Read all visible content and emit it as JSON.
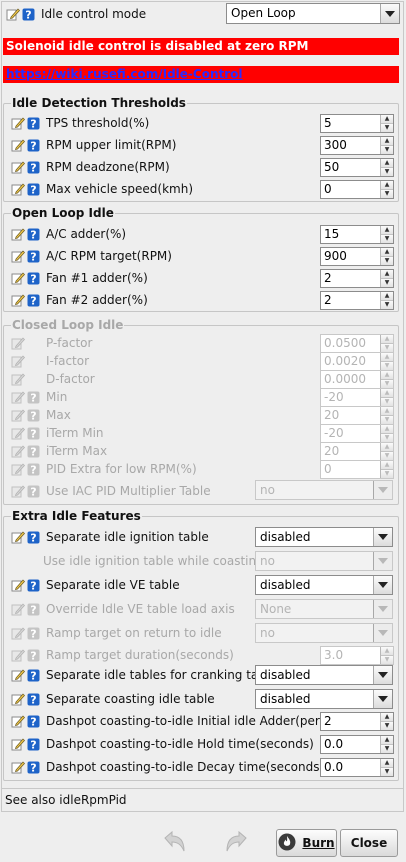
{
  "header": {
    "mode_label": "Idle control mode",
    "mode_value": "Open Loop"
  },
  "banners": {
    "warning": "Solenoid idle control is disabled at zero RPM",
    "link": "https://wiki.rusefi.com/Idle-Control"
  },
  "detection": {
    "title": "Idle Detection Thresholds",
    "fields": [
      {
        "label": "TPS threshold(%)",
        "value": "5"
      },
      {
        "label": "RPM upper limit(RPM)",
        "value": "300"
      },
      {
        "label": "RPM deadzone(RPM)",
        "value": "50"
      },
      {
        "label": "Max vehicle speed(kmh)",
        "value": "0"
      }
    ]
  },
  "open_loop": {
    "title": "Open Loop Idle",
    "fields": [
      {
        "label": "A/C adder(%)",
        "value": "15"
      },
      {
        "label": "A/C RPM target(RPM)",
        "value": "900"
      },
      {
        "label": "Fan #1 adder(%)",
        "value": "2"
      },
      {
        "label": "Fan #2 adder(%)",
        "value": "2"
      }
    ]
  },
  "closed_loop": {
    "title": "Closed Loop Idle",
    "fields": [
      {
        "label": "P-factor",
        "value": "0.0500"
      },
      {
        "label": "I-factor",
        "value": "0.0020"
      },
      {
        "label": "D-factor",
        "value": "0.0000"
      },
      {
        "label": "Min",
        "value": "-20"
      },
      {
        "label": "Max",
        "value": "20"
      },
      {
        "label": "iTerm Min",
        "value": "-20"
      },
      {
        "label": "iTerm Max",
        "value": "20"
      },
      {
        "label": "PID Extra for low RPM(%)",
        "value": "0"
      }
    ],
    "multiplier_label": "Use IAC PID Multiplier Table",
    "multiplier_value": "no"
  },
  "extra": {
    "title": "Extra Idle Features",
    "sep_ign_label": "Separate idle ignition table",
    "sep_ign_value": "disabled",
    "use_ign_coasting_label": "Use idle ignition table while coasting",
    "use_ign_coasting_value": "no",
    "sep_ve_label": "Separate idle VE table",
    "sep_ve_value": "disabled",
    "override_ve_label": "Override Idle VE table load axis",
    "override_ve_value": "None",
    "ramp_target_label": "Ramp target on return to idle",
    "ramp_target_value": "no",
    "ramp_duration_label": "Ramp target duration(seconds)",
    "ramp_duration_value": "3.0",
    "sep_cranking_label": "Separate idle tables for cranking taper",
    "sep_cranking_value": "disabled",
    "sep_coasting_label": "Separate coasting idle table",
    "sep_coasting_value": "disabled",
    "dashpot_adder_label": "Dashpot coasting-to-idle Initial idle Adder(percent)",
    "dashpot_adder_value": "2",
    "dashpot_hold_label": "Dashpot coasting-to-idle Hold time(seconds)",
    "dashpot_hold_value": "0.0",
    "dashpot_decay_label": "Dashpot coasting-to-idle Decay time(seconds)",
    "dashpot_decay_value": "0.0"
  },
  "status": "See also idleRpmPid",
  "footer": {
    "burn_label": "Burn",
    "close_label": "Close"
  },
  "colors": {
    "banner": "#ff0000",
    "help_icon": "#1e63c8",
    "link": "#2a2aff"
  }
}
